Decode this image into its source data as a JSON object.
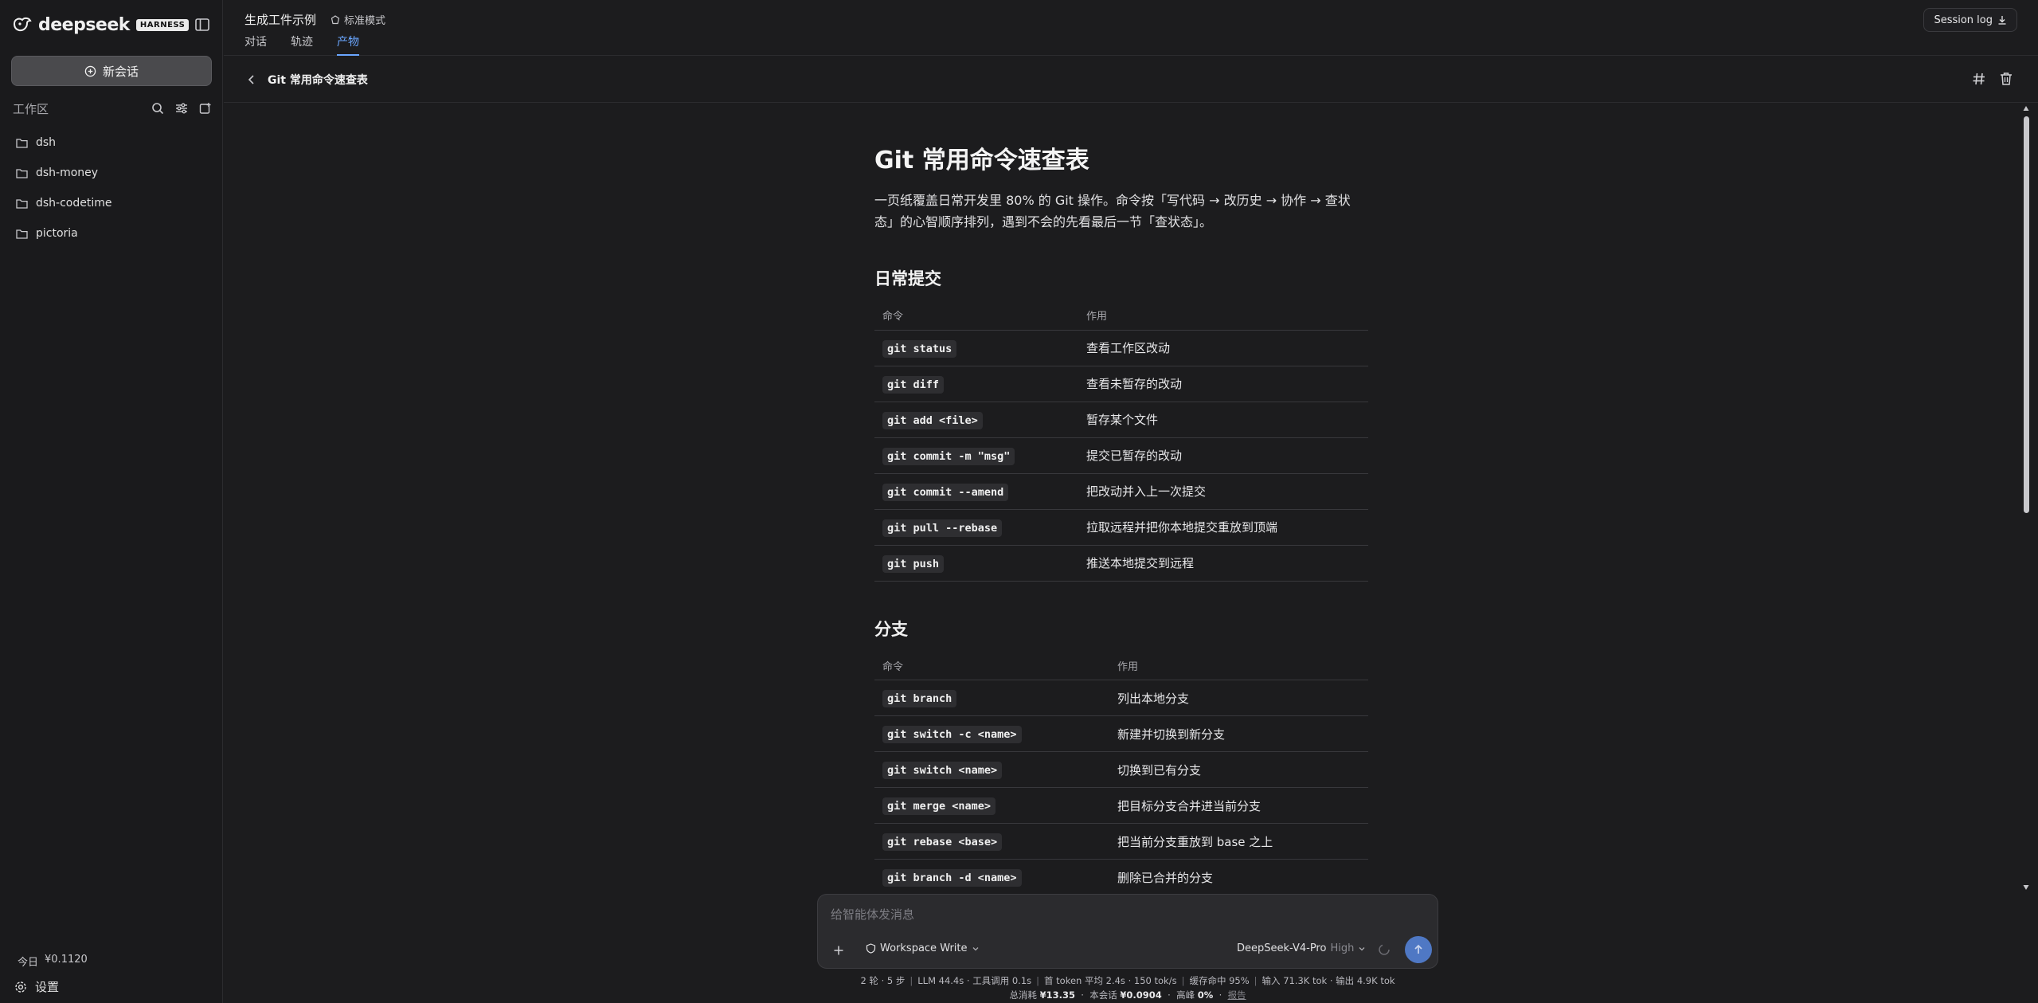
{
  "brand": {
    "name": "deepseek",
    "badge": "HARNESS"
  },
  "sidebar": {
    "new_chat": "新会话",
    "workspace_label": "工作区",
    "items": [
      {
        "label": "dsh"
      },
      {
        "label": "dsh-money"
      },
      {
        "label": "dsh-codetime"
      },
      {
        "label": "pictoria"
      }
    ],
    "cost_label": "今日",
    "cost_value": "¥0.1120",
    "settings": "设置"
  },
  "header": {
    "title": "生成工件示例",
    "mode": "标准模式",
    "tabs": [
      {
        "label": "对话"
      },
      {
        "label": "轨迹"
      },
      {
        "label": "产物",
        "active": true
      }
    ],
    "session_log": "Session log"
  },
  "artifact": {
    "title": "Git 常用命令速查表",
    "doc_title": "Git 常用命令速查表",
    "intro": "一页纸覆盖日常开发里 80% 的 Git 操作。命令按「写代码 → 改历史 → 协作 → 查状态」的心智顺序排列，遇到不会的先看最后一节「查状态」。",
    "sections": [
      {
        "title": "日常提交",
        "col_cmd": "命令",
        "col_desc": "作用",
        "rows": [
          {
            "cmd": "git status",
            "desc": "查看工作区改动"
          },
          {
            "cmd": "git diff",
            "desc": "查看未暂存的改动"
          },
          {
            "cmd": "git add <file>",
            "desc": "暂存某个文件"
          },
          {
            "cmd": "git commit -m \"msg\"",
            "desc": "提交已暂存的改动"
          },
          {
            "cmd": "git commit --amend",
            "desc": "把改动并入上一次提交"
          },
          {
            "cmd": "git pull --rebase",
            "desc": "拉取远程并把你本地提交重放到顶端"
          },
          {
            "cmd": "git push",
            "desc": "推送本地提交到远程"
          }
        ]
      },
      {
        "title": "分支",
        "col_cmd": "命令",
        "col_desc": "作用",
        "rows": [
          {
            "cmd": "git branch",
            "desc": "列出本地分支"
          },
          {
            "cmd": "git switch -c <name>",
            "desc": "新建并切换到新分支"
          },
          {
            "cmd": "git switch <name>",
            "desc": "切换到已有分支"
          },
          {
            "cmd": "git merge <name>",
            "desc": "把目标分支合并进当前分支"
          },
          {
            "cmd": "git rebase <base>",
            "desc": "把当前分支重放到 base 之上"
          },
          {
            "cmd": "git branch -d <name>",
            "desc": "删除已合并的分支"
          }
        ]
      }
    ]
  },
  "composer": {
    "placeholder": "给智能体发消息",
    "permission": "Workspace Write",
    "model": "DeepSeek-V4-Pro",
    "effort": "High"
  },
  "stats": {
    "turns": "2 轮 · 5 步",
    "llm": "LLM 44.4s · 工具调用 0.1s",
    "first_token": "首 token 平均 2.4s · 150 tok/s",
    "cache": "缓存命中 95%",
    "io": "输入 71.3K tok · 输出 4.9K tok",
    "total_label": "总消耗",
    "total_value": "¥13.35",
    "session_label": "本会话",
    "session_value": "¥0.0904",
    "peak_label": "高峰",
    "peak_value": "0%",
    "report": "报告"
  },
  "colors": {
    "accent": "#6aa6ff",
    "send": "#4f78c4",
    "bg": "#1c1c1e"
  }
}
